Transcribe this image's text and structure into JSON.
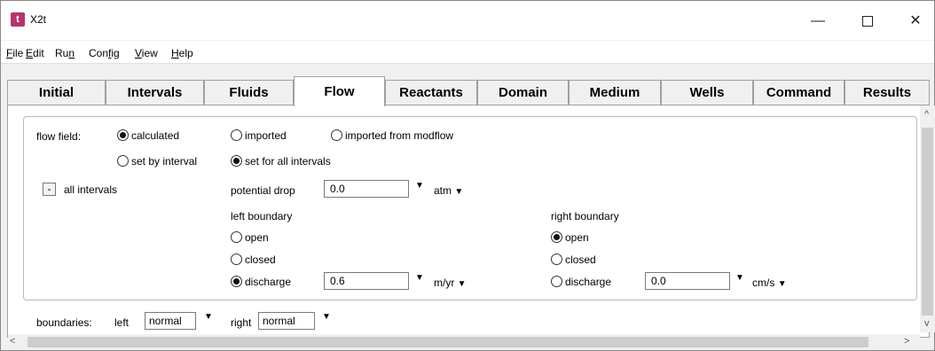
{
  "window": {
    "title": "X2t",
    "icon_letter": "t"
  },
  "window_controls": {
    "minimize": "—",
    "close": "✕"
  },
  "menu": {
    "items": [
      {
        "pre": "",
        "u": "F",
        "post": "ile"
      },
      {
        "pre": "",
        "u": "E",
        "post": "dit"
      },
      {
        "pre": "Ru",
        "u": "n",
        "post": ""
      },
      {
        "pre": "Con",
        "u": "f",
        "post": "ig"
      },
      {
        "pre": "",
        "u": "V",
        "post": "iew"
      },
      {
        "pre": "",
        "u": "H",
        "post": "elp"
      }
    ]
  },
  "tabs": [
    {
      "label": "Initial",
      "active": false
    },
    {
      "label": "Intervals",
      "active": false
    },
    {
      "label": "Fluids",
      "active": false
    },
    {
      "label": "Flow",
      "active": true
    },
    {
      "label": "Reactants",
      "active": false
    },
    {
      "label": "Domain",
      "active": false
    },
    {
      "label": "Medium",
      "active": false
    },
    {
      "label": "Wells",
      "active": false
    },
    {
      "label": "Command",
      "active": false
    },
    {
      "label": "Results",
      "active": false
    }
  ],
  "flow_field": {
    "label": "flow field:",
    "options": {
      "calculated": "calculated",
      "imported": "imported",
      "imported_modflow": "imported from modflow",
      "set_by_interval": "set by interval",
      "set_all": "set for all intervals"
    }
  },
  "intervals": {
    "collapse_glyph": "-",
    "label": "all intervals",
    "potential_drop_label": "potential drop",
    "potential_drop_value": "0.0",
    "potential_drop_unit": "atm"
  },
  "left_boundary": {
    "title": "left boundary",
    "open": "open",
    "closed": "closed",
    "discharge": "discharge",
    "discharge_value": "0.6",
    "discharge_unit": "m/yr"
  },
  "right_boundary": {
    "title": "right boundary",
    "open": "open",
    "closed": "closed",
    "discharge": "discharge",
    "discharge_value": "0.0",
    "discharge_unit": "cm/s"
  },
  "boundaries": {
    "label": "boundaries:",
    "left_label": "left",
    "left_value": "normal",
    "right_label": "right",
    "right_value": "normal"
  },
  "glyphs": {
    "dropdown": "▼",
    "scroll_up": "^",
    "scroll_down": "v",
    "scroll_left": "<",
    "scroll_right": ">"
  }
}
